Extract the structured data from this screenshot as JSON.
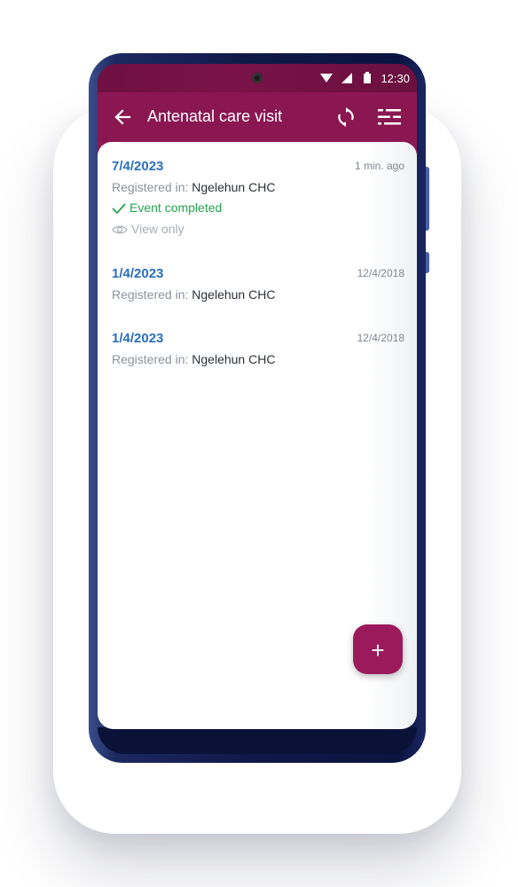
{
  "status_bar": {
    "time": "12:30"
  },
  "app_bar": {
    "title": "Antenatal care visit"
  },
  "events": [
    {
      "date": "7/4/2023",
      "time_ago": "1 min. ago",
      "registered_label": "Registered in:",
      "org_unit": "Ngelehun CHC",
      "status": "Event completed",
      "access": "View only"
    },
    {
      "date": "1/4/2023",
      "time_ago": "12/4/2018",
      "registered_label": "Registered in:",
      "org_unit": "Ngelehun CHC"
    },
    {
      "date": "1/4/2023",
      "time_ago": "12/4/2018",
      "registered_label": "Registered in:",
      "org_unit": "Ngelehun CHC"
    }
  ],
  "fab": {
    "label": "+"
  },
  "colors": {
    "primary": "#8a1752",
    "status_bar": "#6e1041",
    "date_blue": "#2a6fbd",
    "completed_green": "#23a34b",
    "phone_frame": "#0f1847"
  },
  "icons": [
    "back-arrow-icon",
    "sync-icon",
    "filter-icon",
    "check-icon",
    "eye-icon",
    "wifi-icon",
    "signal-icon",
    "battery-icon",
    "add-icon"
  ]
}
